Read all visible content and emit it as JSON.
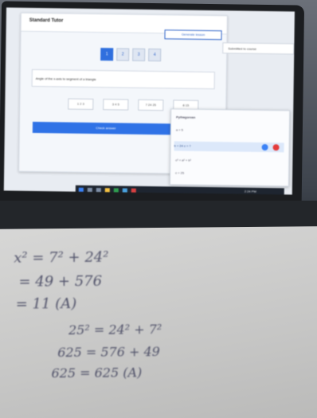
{
  "screen": {
    "app_title": "Standard Tutor",
    "header_button": "Generate lesson",
    "side_panel_text": "Submitted to course",
    "steps": [
      "1",
      "2",
      "3",
      "4"
    ],
    "question": "Angle of the x-axis to segment of a triangle",
    "options": [
      "1 2 3",
      "3 4 5",
      "7 24 25",
      "8 15"
    ],
    "submit_label": "Check answer",
    "popup": {
      "title": "Pythagorean",
      "rows": [
        "a = 5",
        "b = 24 c = ?",
        "c² = a² + b²",
        "c = 25"
      ]
    },
    "clock": "2:24 PM"
  },
  "paper": {
    "lines": [
      "x² = 7² + 24²",
      "= 49 + 576",
      "= 11 (A)",
      "25² = 24² + 7²",
      "625 = 576 + 49",
      "625 = 625 (A)"
    ]
  },
  "colors": {
    "accent": "#2f6fde",
    "ink": "#3a3c58",
    "paper": "#cfcfce"
  }
}
